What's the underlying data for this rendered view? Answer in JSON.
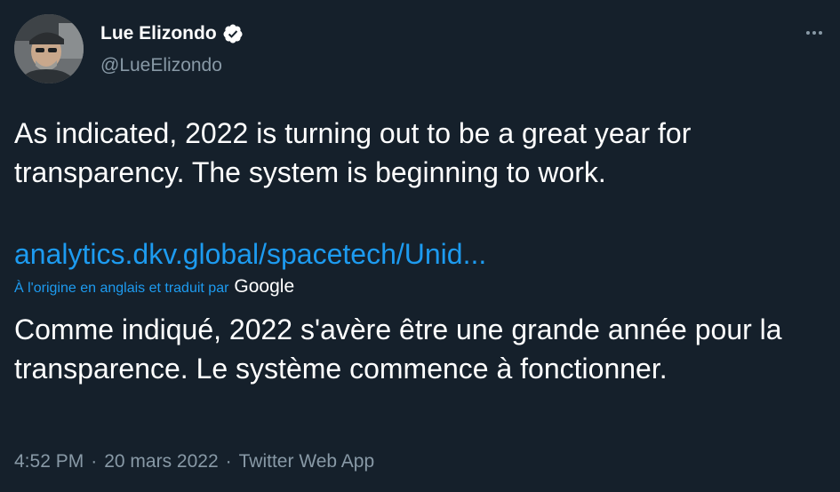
{
  "author": {
    "display_name": "Lue Elizondo",
    "handle": "@LueElizondo",
    "verified": true,
    "avatar_icon": "profile-photo"
  },
  "more_icon": "more-horizontal-icon",
  "tweet": {
    "text": "As indicated, 2022 is turning out to be a great year for transparency. The system is beginning to work.",
    "link_text": "analytics.dkv.global/spacetech/Unid...",
    "translation_label": "À l'origine en anglais et traduit par",
    "translation_provider": "Google",
    "translated_text": "Comme indiqué, 2022 s'avère être une grande année pour la transparence. Le système commence à fonctionner."
  },
  "meta": {
    "time": "4:52 PM",
    "date": "20 mars 2022",
    "source": "Twitter Web App",
    "separator": "·"
  },
  "colors": {
    "background": "#15202b",
    "link": "#1d9bf0",
    "secondary_text": "#8899a6"
  }
}
